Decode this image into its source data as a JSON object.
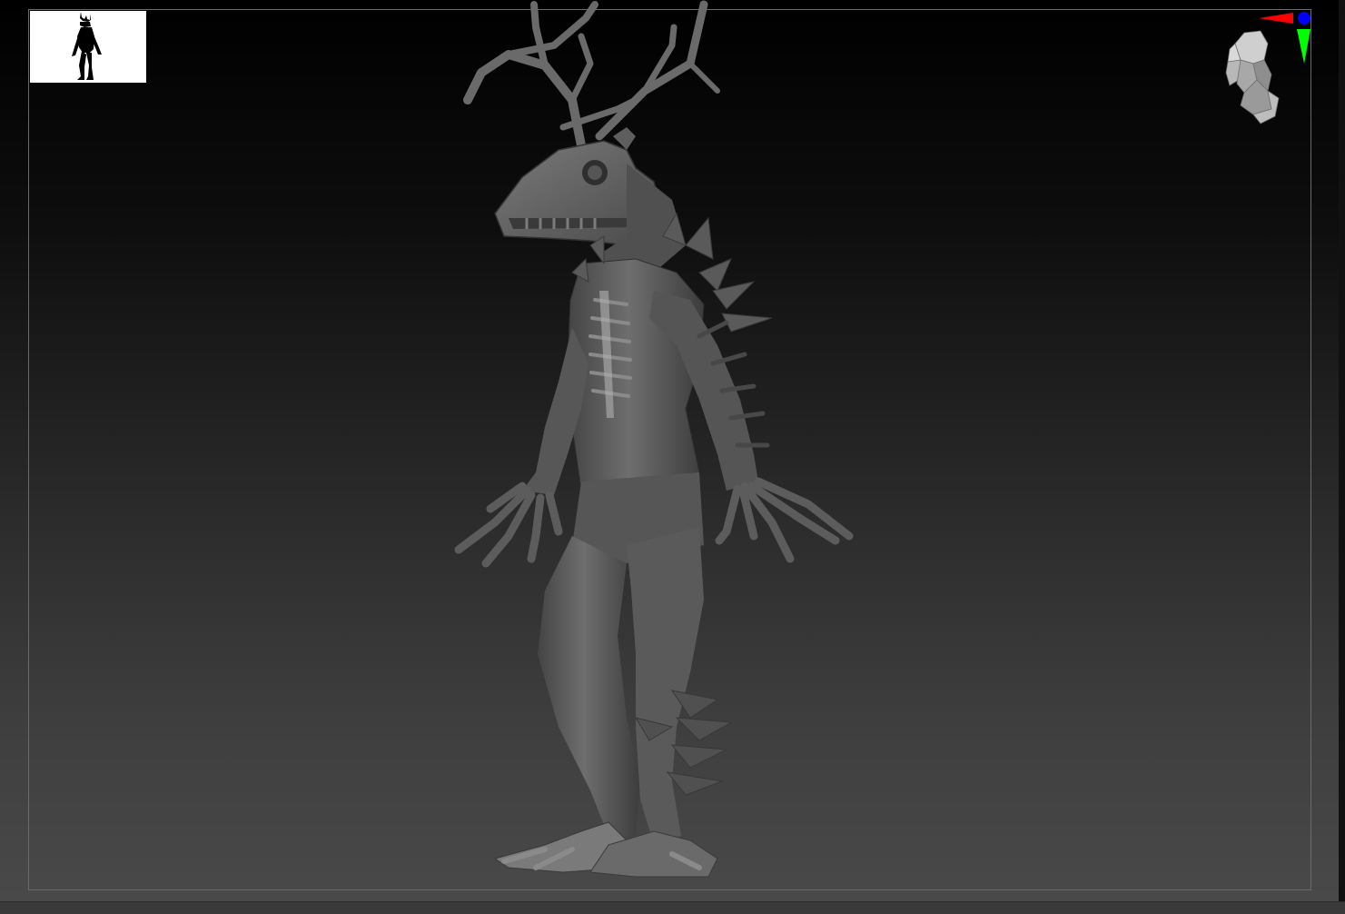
{
  "viewport": {
    "background": {
      "top": "#000000",
      "bottom": "#4a4a4a"
    },
    "frame_color": "#6a6a6a",
    "mesh_color": "#5a5a5a",
    "mesh_highlight": "#8a8a8a"
  },
  "thumbnail": {
    "icon": "creature-silhouette-icon"
  },
  "navigator": {
    "icon": "head-navigation-icon",
    "axis_colors": {
      "x": "#ff0000",
      "y": "#00ff00",
      "z": "#0000ff"
    }
  },
  "model": {
    "icon": "wendigo-sculpt-mesh"
  }
}
